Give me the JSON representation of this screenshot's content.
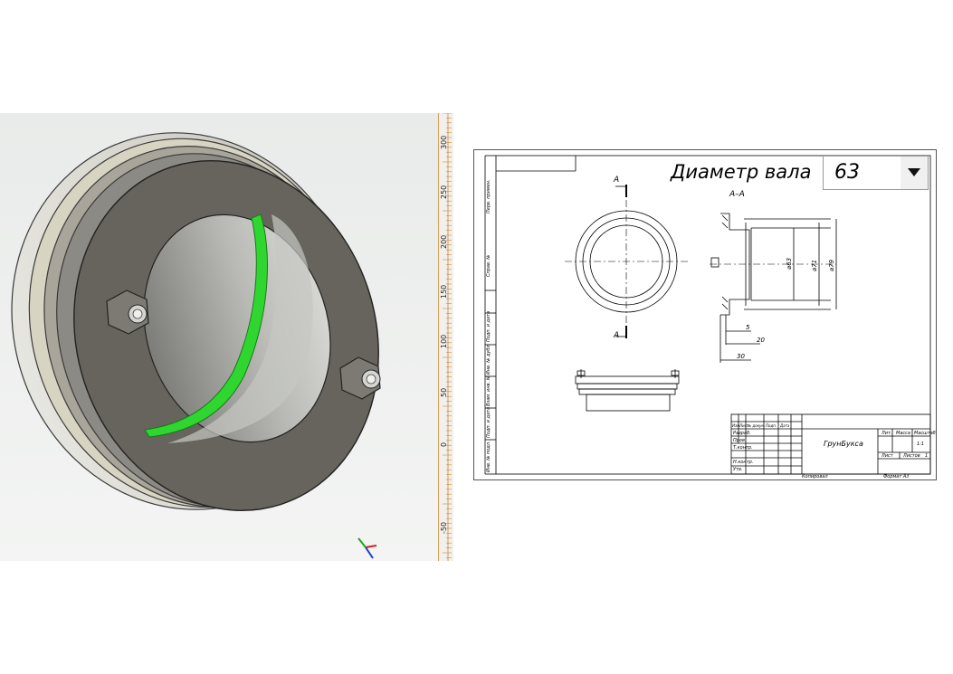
{
  "model_view": {
    "ruler_labels": [
      "300",
      "250",
      "200",
      "150",
      "100",
      "50",
      "0",
      "-50"
    ]
  },
  "drawing": {
    "parameter_label": "Диаметр вала",
    "parameter_value": "63",
    "section_label": "A–A",
    "cut_labels": [
      "A",
      "A"
    ],
    "dimensions": {
      "d_inner": "⌀63",
      "d_mid": "⌀71",
      "d_outer": "⌀79",
      "w_5": "5",
      "w_20": "20",
      "w_30": "30"
    },
    "title_block": {
      "name": "ГрунБукса",
      "format": "Формат  А3",
      "copied": "Копировал",
      "razrab": "Разраб.",
      "prov": "Пров.",
      "tkontr": "Т.контр.",
      "nkontr": "Н.контр.",
      "utv": "Утв.",
      "izm": "Изм.",
      "list": "Лист",
      "ndokum": "№ докум.",
      "podp": "Подп.",
      "data": "Дата",
      "lit": "Лит.",
      "massa": "Масса",
      "masshtab": "Масштаб",
      "scale_value": "1:1",
      "list2": "Лист",
      "listov": "Листов",
      "listov_value": "1"
    },
    "side_stamps": [
      "Перв. примен.",
      "Справ. №",
      "Подп. и дата",
      "Инв. № дубл.",
      "Взам. инв. №",
      "Подп. и дата",
      "Инв. № подл."
    ]
  }
}
